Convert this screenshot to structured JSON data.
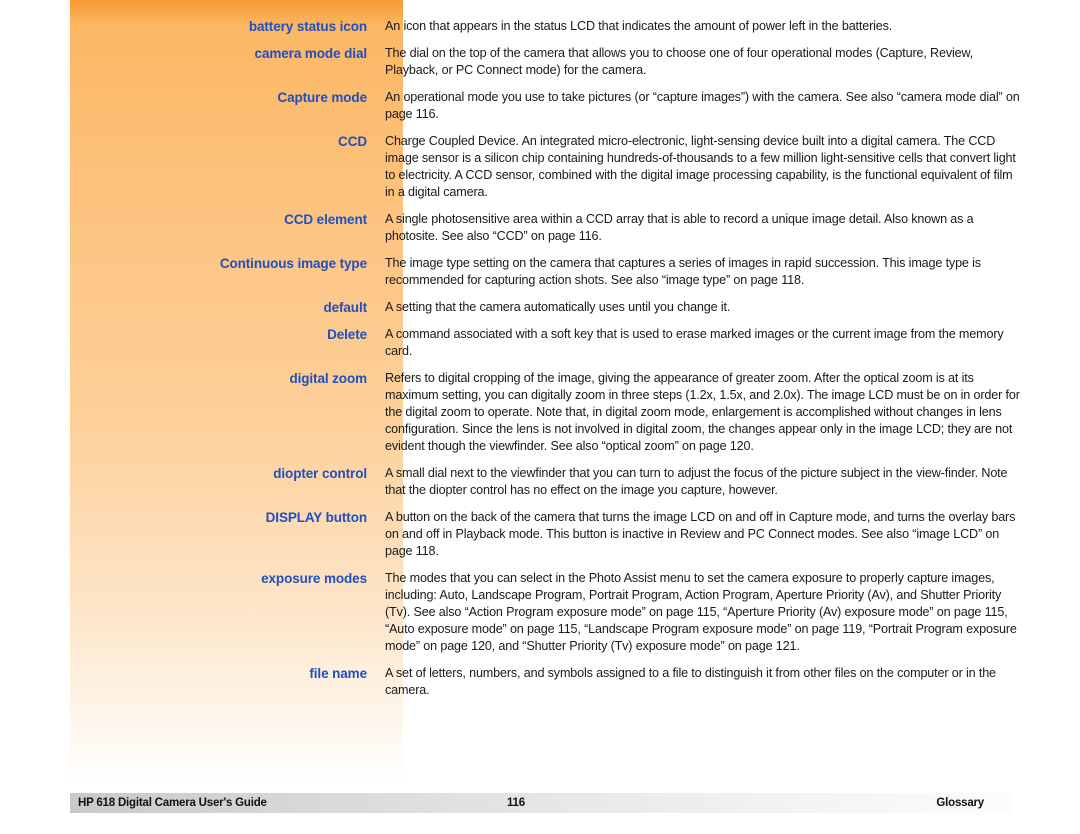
{
  "document": {
    "title": "HP 618 Digital Camera User's Guide",
    "section": "Glossary",
    "page_number": "116",
    "accent_term_color": "#1f4fc0",
    "panel_gradient_top": "#f79a34",
    "panel_gradient_bottom": "#ffffff"
  },
  "glossary": {
    "entries": [
      {
        "term": "battery status icon",
        "definition": "An icon that appears in the status LCD that indicates the amount of power left in the batteries."
      },
      {
        "term": "camera mode dial",
        "definition": "The dial on the top of the camera that allows you to choose one of four operational modes (Capture, Review, Playback, or PC Connect mode) for the camera."
      },
      {
        "term": "Capture mode",
        "definition": "An operational mode you use to take pictures (or “capture images”) with the camera. See also “camera mode dial” on page 116."
      },
      {
        "term": "CCD",
        "definition": "Charge Coupled Device. An integrated micro-electronic, light-sensing device built into a digital camera. The CCD image sensor is a silicon chip containing hundreds-of-thousands to a few million light-sensitive cells that convert light to electricity. A CCD sensor, combined with the digital image processing capability, is the functional equivalent of film in a digital camera."
      },
      {
        "term": "CCD element",
        "definition": "A single photosensitive area within a CCD array that is able to record a unique image detail. Also known as a photosite. See also “CCD” on page 116."
      },
      {
        "term": "Continuous image type",
        "definition": "The image type setting on the camera that captures a series of images in rapid succession. This image type is recommended for capturing action shots. See also “image type” on page 118."
      },
      {
        "term": "default",
        "definition": "A setting that the camera automatically uses until you change it."
      },
      {
        "term": "Delete",
        "definition": "A command associated with a soft key that is used to erase marked images or the current image from the memory card."
      },
      {
        "term": "digital zoom",
        "definition": "Refers to digital cropping of the image, giving the appearance of greater zoom. After the optical zoom is at its maximum setting, you can digitally zoom in three steps (1.2x, 1.5x, and 2.0x). The image LCD must be on in order for the digital zoom to operate. Note that, in digital zoom mode, enlargement is accomplished without changes in lens configuration. Since the lens is not involved in digital zoom, the changes appear only in the image LCD; they are not evident though the viewfinder. See also “optical zoom” on page 120."
      },
      {
        "term": "diopter control",
        "definition": "A small dial next to the viewfinder that you can turn to adjust the focus of the picture subject in the view-finder. Note that the diopter control has no effect on the image you capture, however."
      },
      {
        "term": "DISPLAY button",
        "definition": "A button on the back of the camera that turns the image LCD on and off in Capture mode, and turns the overlay bars on and off in Playback mode. This button is inactive in Review and PC Connect modes. See also “image LCD” on page 118."
      },
      {
        "term": "exposure modes",
        "definition": "The modes that you can select in the Photo Assist menu to set the camera exposure to properly capture images, including: Auto, Landscape Program, Portrait Program, Action Program, Aperture Priority (Av), and Shutter Priority (Tv). See also “Action Program exposure mode” on page 115, “Aperture Priority (Av) exposure mode” on page 115, “Auto exposure mode” on page 115, “Landscape Program exposure mode” on page 119, “Portrait Program exposure mode” on page 120, and “Shutter Priority (Tv) exposure mode” on page 121."
      },
      {
        "term": "file name",
        "definition": "A set of letters, numbers, and symbols assigned to a file to distinguish it from other files on the computer or in the camera."
      }
    ]
  },
  "footer": {
    "left": "HP 618 Digital Camera User's Guide",
    "center": "116",
    "right": "Glossary"
  }
}
